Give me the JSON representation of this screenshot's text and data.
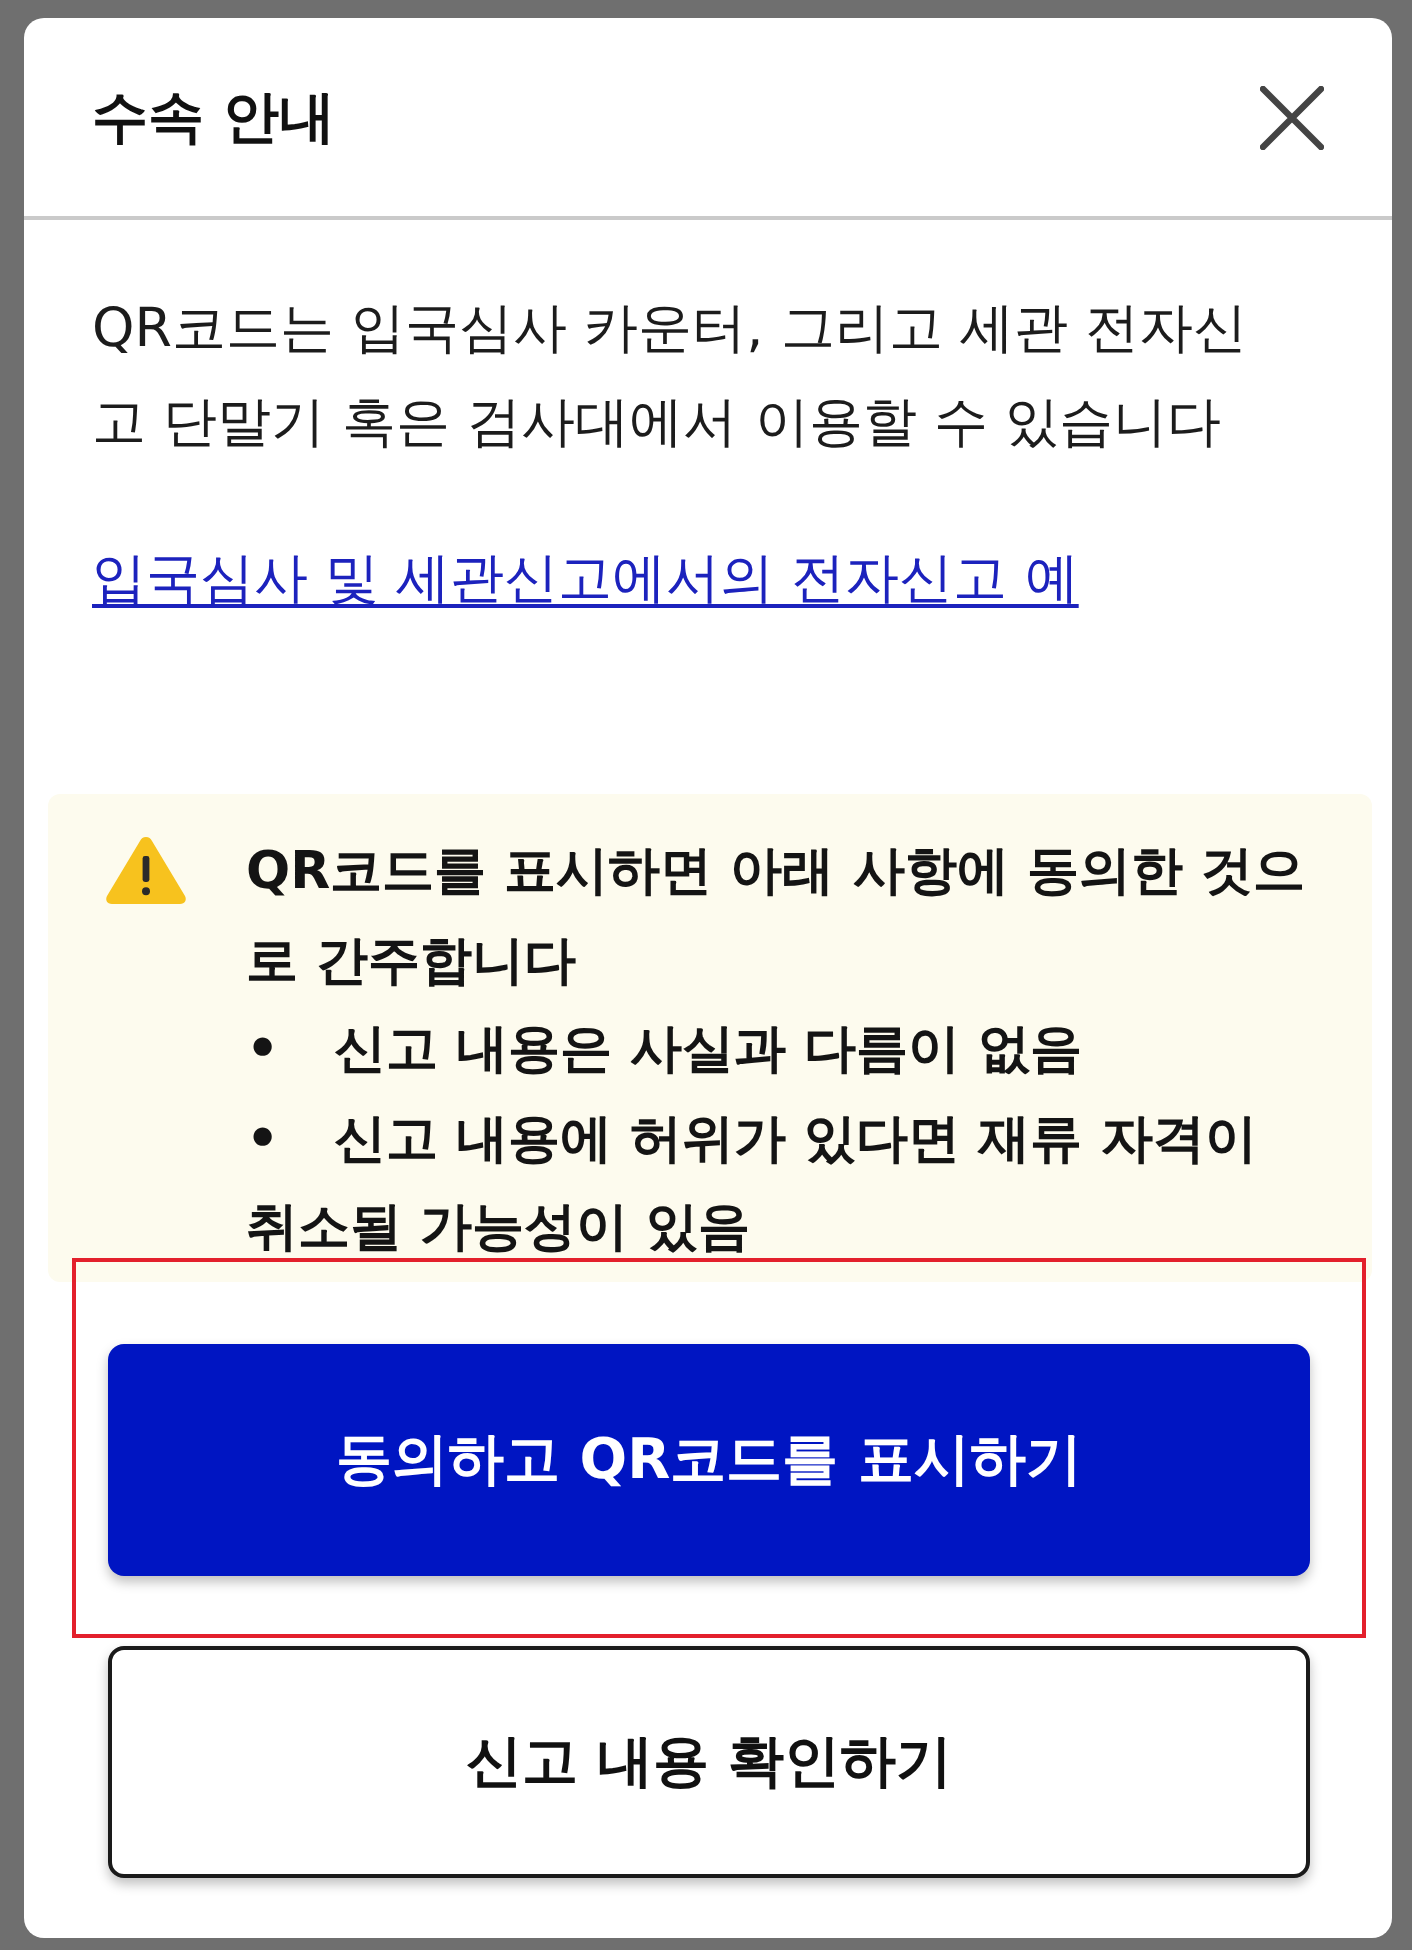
{
  "dialog": {
    "title": "수속 안내"
  },
  "body": {
    "text": "QR코드는 입국심사 카운터, 그리고 세관 전자신고 단말기 혹은 검사대에서 이용할 수 있습니다",
    "link": "입국심사 및 세관신고에서의 전자신고 예"
  },
  "notice": {
    "text": "QR코드를 표시하면 아래 사항에 동의한 것으로 간주합니다",
    "items": [
      "•\t신고 내용은 사실과 다름이 없음",
      "•\t신고 내용에 허위가 있다면 재류 자격이 취소될 가능성이 있음"
    ]
  },
  "buttons": [
    {
      "label": "동의하고 QR코드를 표시하기",
      "kind": "primary",
      "highlighted": true
    },
    {
      "label": "신고 내용 확인하기",
      "kind": "secondary",
      "highlighted": false
    }
  ]
}
